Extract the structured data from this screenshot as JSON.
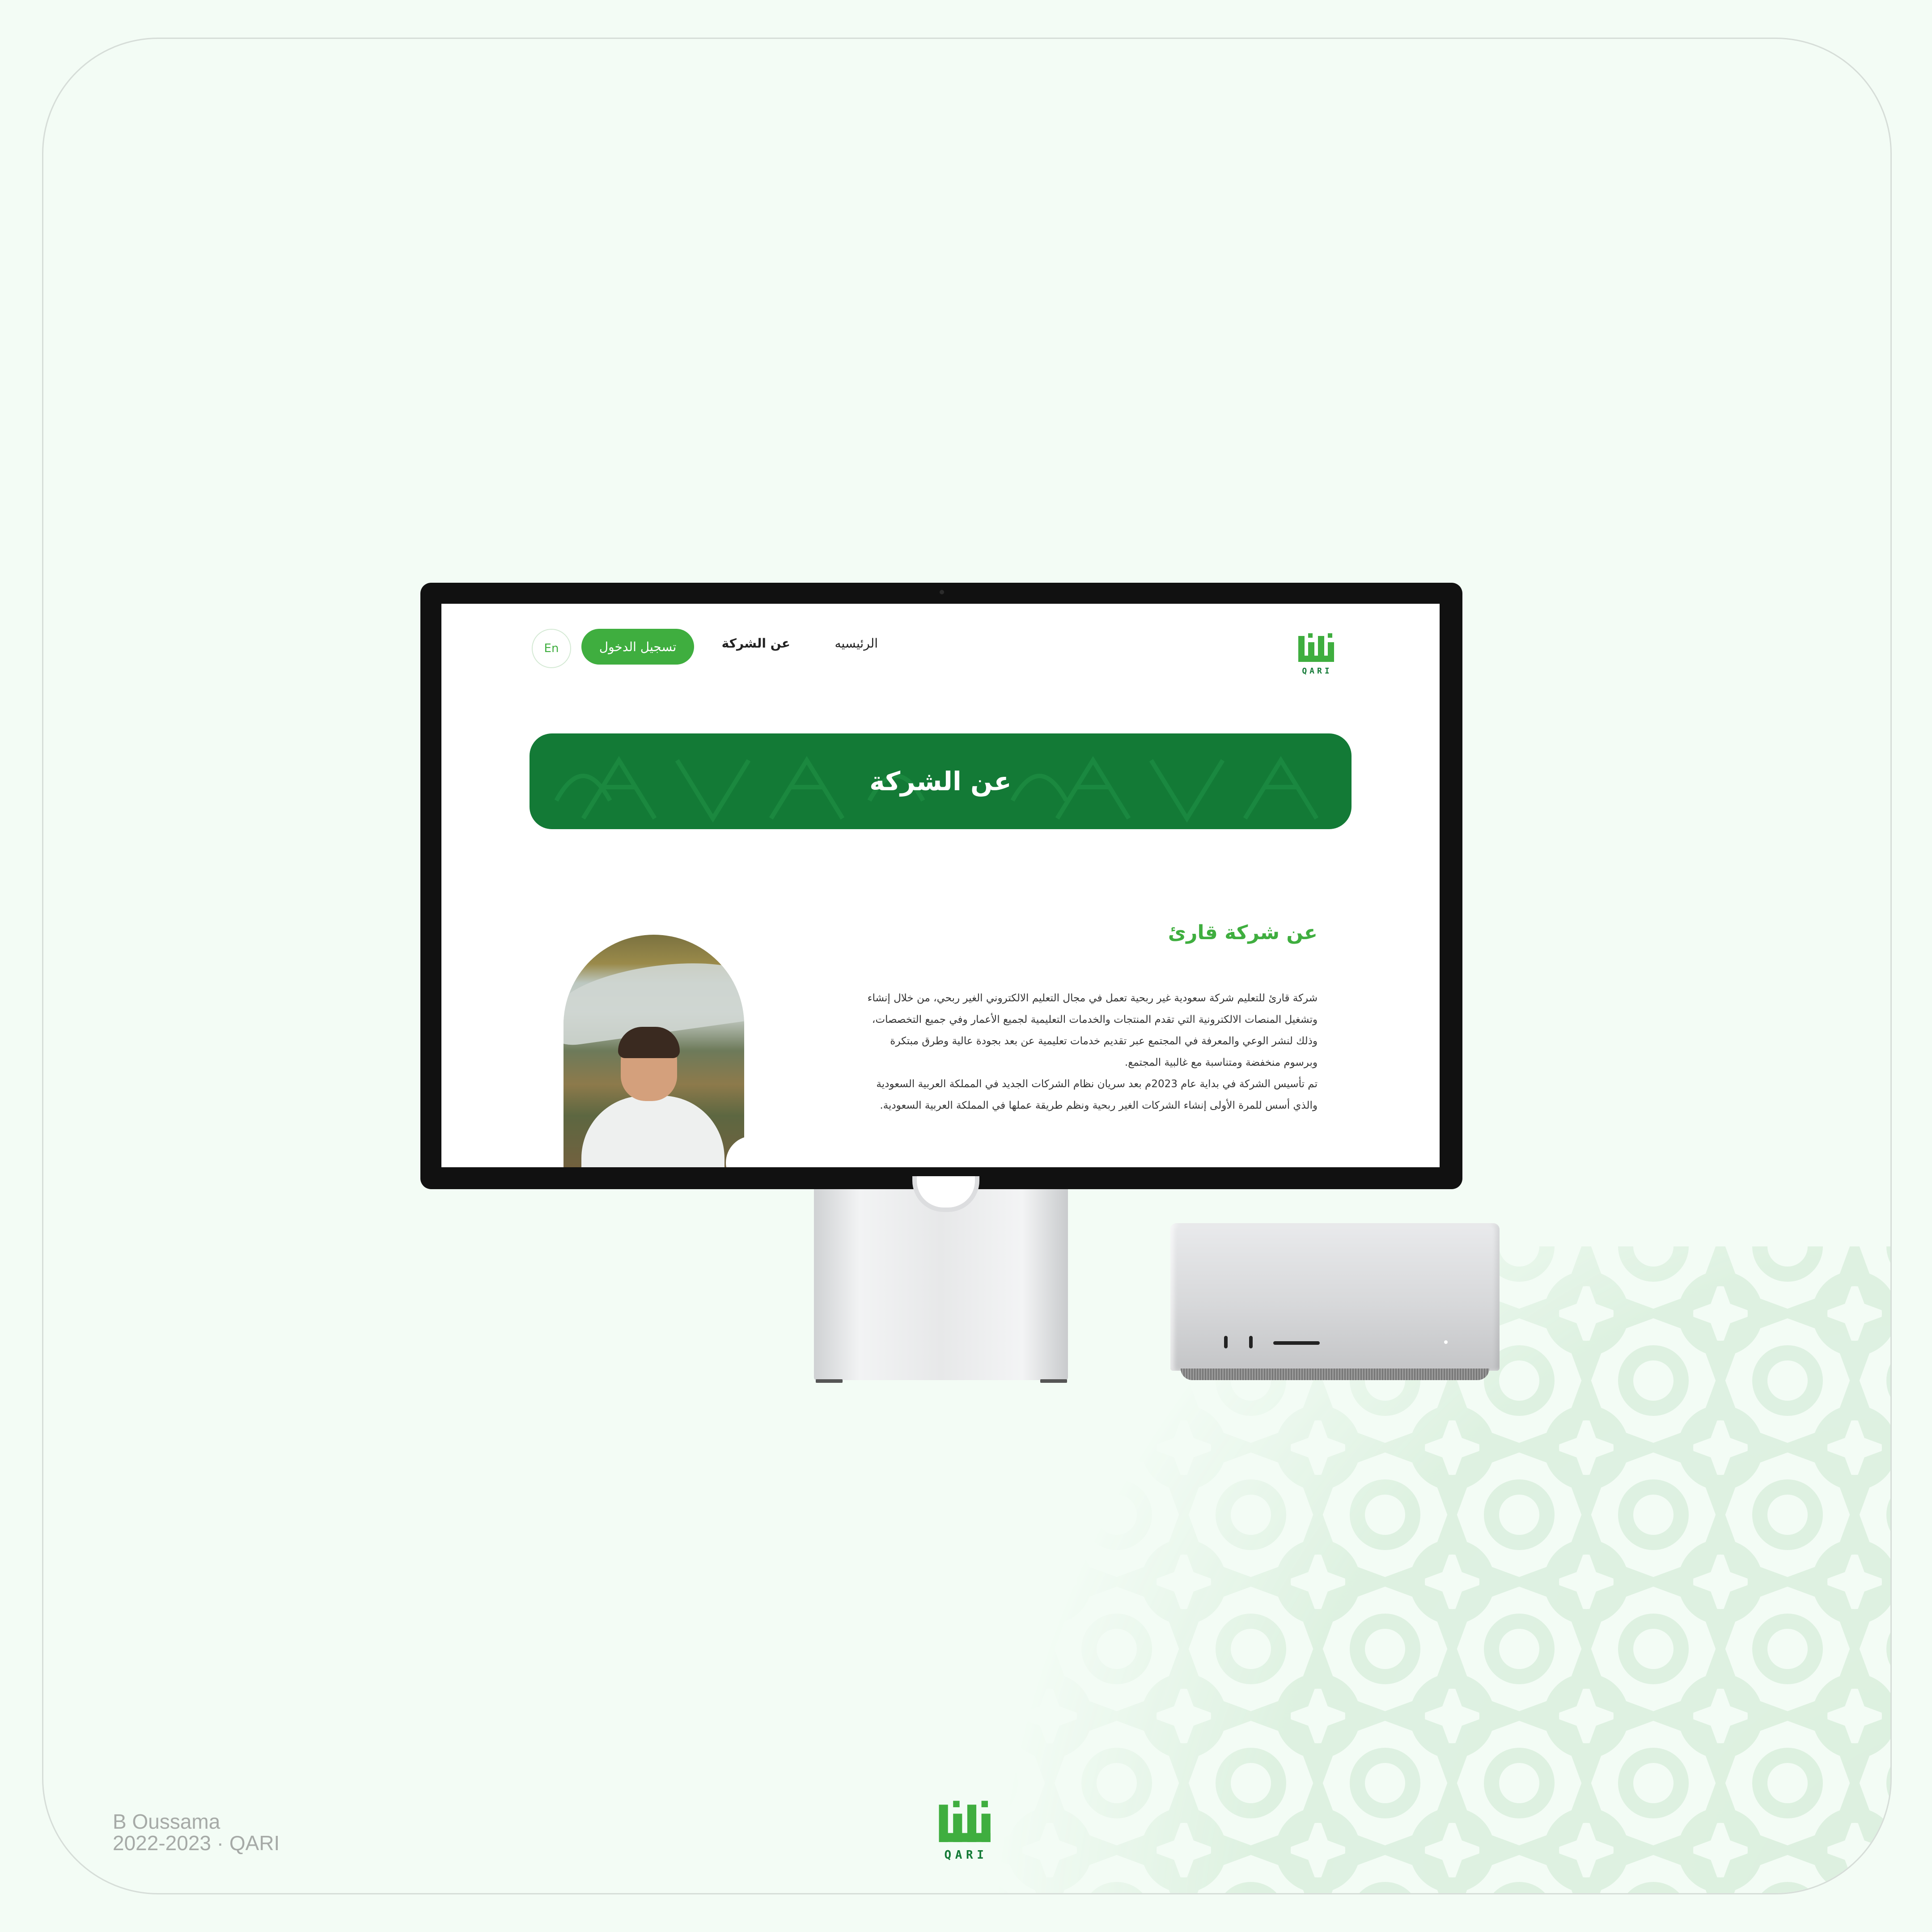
{
  "site": {
    "nav": {
      "home_label": "الرئيسيه",
      "about_label": "عن الشركة",
      "login_label": "تسجيل الدخول",
      "lang_label": "En"
    },
    "logo_wordmark": "QARI",
    "hero_title": "عن الشركة",
    "about_heading": "عن شركة قارئ",
    "about_paragraph_1": "شركة قارئ للتعليم شركة سعودية غير ربحية تعمل في مجال التعليم الالكتروني الغير ربحي، من خلال إنشاء وتشغيل المنصات الالكترونية التي تقدم المنتجات والخدمات التعليمية لجميع الأعمار وفي جميع التخصصات، وذلك لنشر الوعي والمعرفة في المجتمع عبر تقديم خدمات تعليمية عن بعد بجودة عالية وطرق مبتكرة وبرسوم منخفضة ومتناسبة مع غالبية المجتمع.",
    "about_paragraph_2": "تم تأسيس الشركة في بداية عام 2023م بعد سريان نظام الشركات الجديد في المملكة العربية السعودية والذي أسس للمرة الأولى إنشاء الشركات الغير ربحية ونظم طريقة عملها في المملكة العربية السعودية.",
    "image": "man-reading-outdoors-photo"
  },
  "credits": {
    "author": "B Oussama",
    "years_project": "2022-2023 · QARI"
  },
  "footer_logo_wordmark": "QARI",
  "colors": {
    "brand_green": "#3fae3f",
    "hero_green": "#137a36",
    "page_bg": "#f3fcf5"
  },
  "icons": {
    "logo": "qari-logo-icon",
    "pattern": "islamic-star-pattern"
  }
}
